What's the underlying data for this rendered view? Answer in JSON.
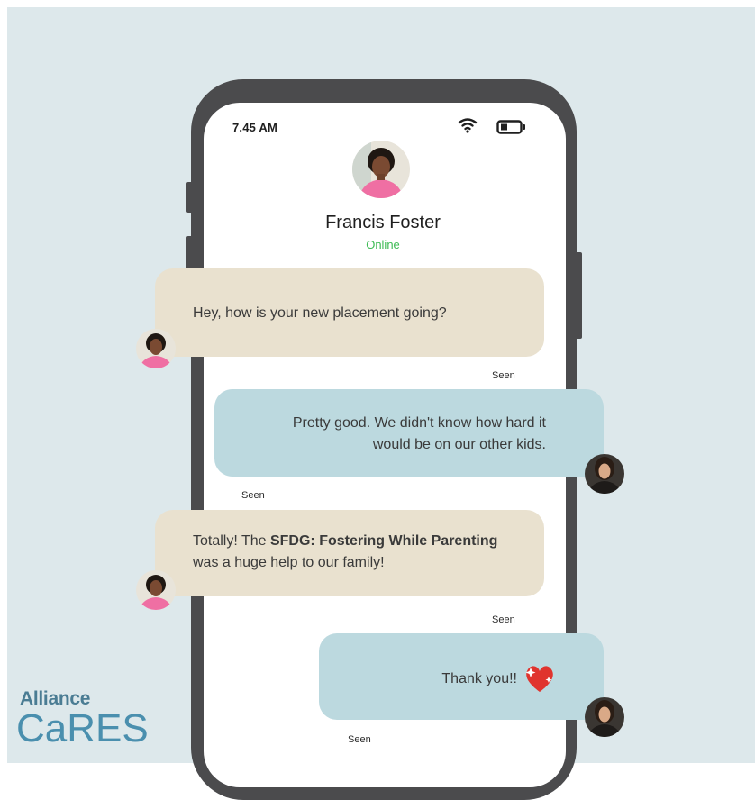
{
  "status_bar": {
    "time": "7.45 AM",
    "wifi_icon": "wifi-icon",
    "battery_icon": "battery-icon"
  },
  "contact": {
    "name": "Francis Foster",
    "status": "Online",
    "status_color": "#3dbb54"
  },
  "messages": [
    {
      "sender": "Francis Foster",
      "side": "left",
      "bubble_color": "#e9e1cf",
      "text": "Hey, how is your new placement going?",
      "receipt": "Seen"
    },
    {
      "sender": "user",
      "side": "right",
      "bubble_color": "#bcd9df",
      "line1": "Pretty good. We didn't know how hard it",
      "line2": "would be on our other kids.",
      "receipt": "Seen"
    },
    {
      "sender": "Francis Foster",
      "side": "left",
      "bubble_color": "#e9e1cf",
      "part1": "Totally! The ",
      "bold": "SFDG: Fostering While Parenting",
      "line2": "was a huge help to our family!",
      "receipt": "Seen"
    },
    {
      "sender": "user",
      "side": "right",
      "bubble_color": "#bcd9df",
      "text": "Thank you!!",
      "emoji": "sparkling-heart-icon",
      "receipt": "Seen"
    }
  ],
  "logo": {
    "line1": "Alliance",
    "line2": "CaRES",
    "color": "#4a8fae"
  },
  "colors": {
    "background": "#dde8eb",
    "phone_frame": "#4b4b4d",
    "screen": "#ffffff"
  }
}
